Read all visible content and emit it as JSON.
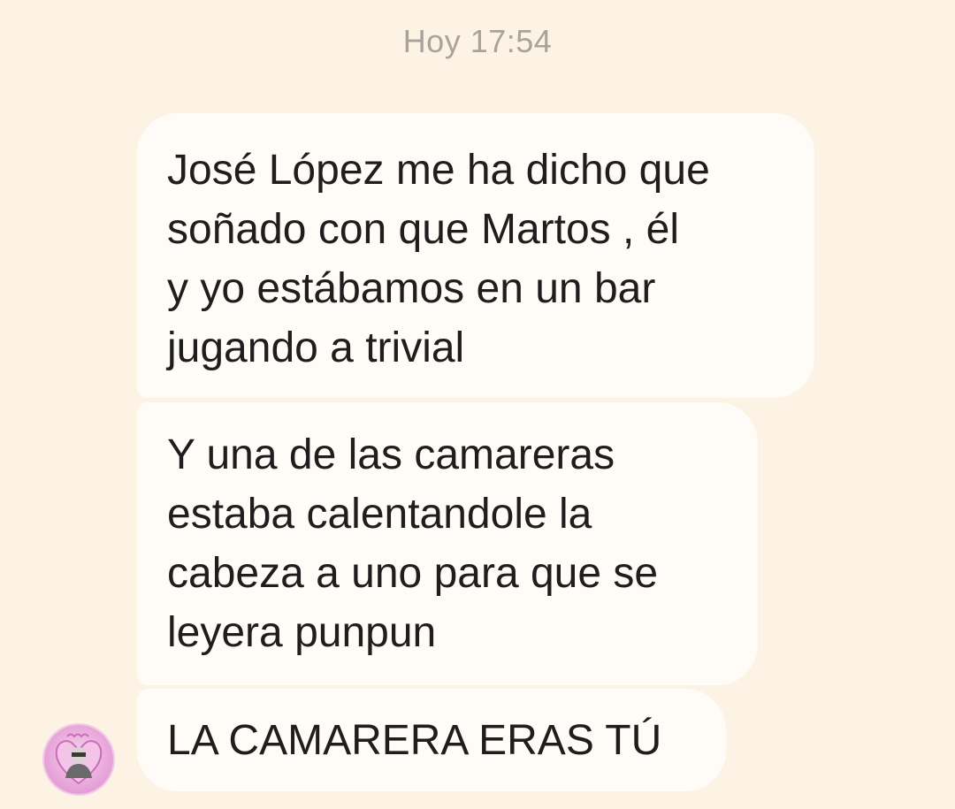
{
  "conversation": {
    "timestamp": "Hoy 17:54",
    "messages": [
      {
        "text": "José López me ha dicho que\nsoñado con que Martos , él\ny yo estábamos en un bar\njugando a trivial"
      },
      {
        "text": "Y una de las camareras\nestaba calentandole la\ncabeza a uno para que se\nleyera punpun"
      },
      {
        "text": "LA CAMARERA ERAS TÚ"
      }
    ],
    "sender_avatar": {
      "icon": "user-avatar",
      "accent": "#e9a9dc"
    }
  },
  "colors": {
    "background": "#fdf3e4",
    "bubble": "#fffcf7",
    "text": "#1e1e1e",
    "timestamp": "#a9a39c"
  }
}
